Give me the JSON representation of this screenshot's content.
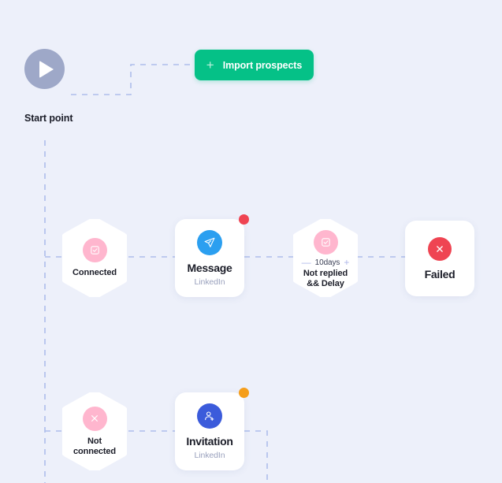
{
  "canvas": {
    "background_color": "#EDF0FA",
    "connector_color": "#AEBDEB"
  },
  "start": {
    "icon": "play-icon",
    "label": "Start point",
    "circle_color": "#9EA8C8"
  },
  "toolbar": {
    "import_button": {
      "label": "Import prospects",
      "icon": "plus-icon",
      "plus": "+",
      "color": "#05C187"
    }
  },
  "nodes": [
    {
      "id": "connected",
      "type": "condition",
      "shape": "hexagon",
      "label": "Connected",
      "icon": "checkbox-icon",
      "icon_color": "#FFB6CE"
    },
    {
      "id": "message",
      "type": "action",
      "shape": "card",
      "title": "Message",
      "subtitle": "LinkedIn",
      "icon": "send-icon",
      "icon_color": "#2B9FF0",
      "badge": "red-status-dot",
      "badge_color": "#EF4452"
    },
    {
      "id": "delay",
      "type": "condition",
      "shape": "hexagon",
      "label": "Not replied\n&& Delay",
      "label_line1": "Not replied",
      "label_line2": "&& Delay",
      "icon": "checkbox-icon",
      "icon_color": "#FFB6CE",
      "stepper": {
        "decrement": "—",
        "value": "10days",
        "increment": "+"
      }
    },
    {
      "id": "failed",
      "type": "terminal",
      "shape": "card",
      "title": "Failed",
      "icon": "close-circle-icon",
      "icon_color": "#EF4452"
    },
    {
      "id": "not-connected",
      "type": "condition",
      "shape": "hexagon",
      "label_line1": "Not",
      "label_line2": "connected",
      "icon": "close-icon",
      "icon_color": "#FFB6CE"
    },
    {
      "id": "invitation",
      "type": "action",
      "shape": "card",
      "title": "Invitation",
      "subtitle": "LinkedIn",
      "icon": "person-add-icon",
      "icon_color": "#3B5BDB",
      "badge": "orange-status-dot",
      "badge_color": "#F59E1B"
    }
  ]
}
